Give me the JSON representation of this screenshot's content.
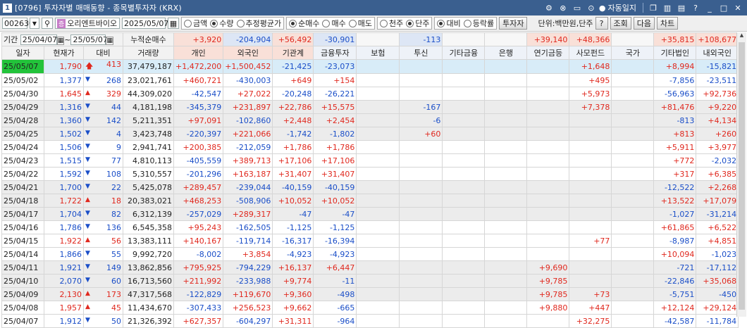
{
  "title": {
    "num": "1",
    "text": "[0796] 투자자별 매매동향 - 종목별투자자 (KRX)",
    "autolock": "자동일지"
  },
  "toolbar": {
    "code": "002630",
    "name": "오리엔트바이오",
    "date": "2025/05/07",
    "r1": [
      "금액",
      "수량",
      "추정평균가"
    ],
    "r1sel": 1,
    "r2": [
      "순매수",
      "매수",
      "매도"
    ],
    "r2sel": 0,
    "r3": [
      "천주",
      "단주"
    ],
    "r3sel": 1,
    "r4": [
      "대비",
      "등락률"
    ],
    "r4sel": 0,
    "investor_btn": "투자자",
    "unit": "단위:백만원,단주",
    "help": "?",
    "lookup": "조회",
    "next": "다음",
    "chart": "차트"
  },
  "period": {
    "label": "기간",
    "from": "25/04/07",
    "tilde": "~",
    "to": "25/05/07",
    "cumul": "누적순매수"
  },
  "headers": [
    "일자",
    "현재가",
    "대비",
    "거래량",
    "개인",
    "외국인",
    "기관계",
    "금융투자",
    "보험",
    "투신",
    "기타금융",
    "은행",
    "연기금등",
    "사모펀드",
    "국가",
    "기타법인",
    "내외국인"
  ],
  "summary": [
    "",
    "",
    "",
    "",
    "+3,920",
    "-204,904",
    "+56,492",
    "-30,901",
    "",
    "-113",
    "",
    "",
    "+39,140",
    "+48,366",
    "",
    "+35,815",
    "+108,677"
  ],
  "rows": [
    {
      "d": "25/05/07",
      "p": "1,790",
      "dir": "up2",
      "c": "413",
      "v": "37,479,187",
      "vals": [
        "+1,472,200",
        "+1,500,452",
        "-21,425",
        "-23,073",
        "",
        "",
        "",
        "",
        "",
        "+1,648",
        "",
        "+8,994",
        "-15,821"
      ]
    },
    {
      "d": "25/05/02",
      "p": "1,377",
      "dir": "dn",
      "c": "268",
      "v": "23,021,761",
      "vals": [
        "+460,721",
        "-430,003",
        "+649",
        "+154",
        "",
        "",
        "",
        "",
        "",
        "+495",
        "",
        "-7,856",
        "-23,511"
      ]
    },
    {
      "d": "25/04/30",
      "p": "1,645",
      "dir": "up",
      "c": "329",
      "v": "44,309,020",
      "vals": [
        "-42,547",
        "+27,022",
        "-20,248",
        "-26,221",
        "",
        "",
        "",
        "",
        "",
        "+5,973",
        "",
        "-56,963",
        "+92,736"
      ]
    },
    {
      "d": "25/04/29",
      "p": "1,316",
      "dir": "dn",
      "c": "44",
      "v": "4,181,198",
      "vals": [
        "-345,379",
        "+231,897",
        "+22,786",
        "+15,575",
        "",
        "-167",
        "",
        "",
        "",
        "+7,378",
        "",
        "+81,476",
        "+9,220"
      ]
    },
    {
      "d": "25/04/28",
      "p": "1,360",
      "dir": "dn",
      "c": "142",
      "v": "5,211,351",
      "vals": [
        "+97,091",
        "-102,860",
        "+2,448",
        "+2,454",
        "",
        "-6",
        "",
        "",
        "",
        "",
        "",
        "-813",
        "+4,134"
      ]
    },
    {
      "d": "25/04/25",
      "p": "1,502",
      "dir": "dn",
      "c": "4",
      "v": "3,423,748",
      "vals": [
        "-220,397",
        "+221,066",
        "-1,742",
        "-1,802",
        "",
        "+60",
        "",
        "",
        "",
        "",
        "",
        "+813",
        "+260"
      ]
    },
    {
      "d": "25/04/24",
      "p": "1,506",
      "dir": "dn",
      "c": "9",
      "v": "2,941,741",
      "vals": [
        "+200,385",
        "-212,059",
        "+1,786",
        "+1,786",
        "",
        "",
        "",
        "",
        "",
        "",
        "",
        "+5,911",
        "+3,977"
      ]
    },
    {
      "d": "25/04/23",
      "p": "1,515",
      "dir": "dn",
      "c": "77",
      "v": "4,810,113",
      "vals": [
        "-405,559",
        "+389,713",
        "+17,106",
        "+17,106",
        "",
        "",
        "",
        "",
        "",
        "",
        "",
        "+772",
        "-2,032"
      ]
    },
    {
      "d": "25/04/22",
      "p": "1,592",
      "dir": "dn",
      "c": "108",
      "v": "5,310,557",
      "vals": [
        "-201,296",
        "+163,187",
        "+31,407",
        "+31,407",
        "",
        "",
        "",
        "",
        "",
        "",
        "",
        "+317",
        "+6,385"
      ]
    },
    {
      "d": "25/04/21",
      "p": "1,700",
      "dir": "dn",
      "c": "22",
      "v": "5,425,078",
      "vals": [
        "+289,457",
        "-239,044",
        "-40,159",
        "-40,159",
        "",
        "",
        "",
        "",
        "",
        "",
        "",
        "-12,522",
        "+2,268"
      ]
    },
    {
      "d": "25/04/18",
      "p": "1,722",
      "dir": "up",
      "c": "18",
      "v": "20,383,021",
      "vals": [
        "+468,253",
        "-508,906",
        "+10,052",
        "+10,052",
        "",
        "",
        "",
        "",
        "",
        "",
        "",
        "+13,522",
        "+17,079"
      ]
    },
    {
      "d": "25/04/17",
      "p": "1,704",
      "dir": "dn",
      "c": "82",
      "v": "6,312,139",
      "vals": [
        "-257,029",
        "+289,317",
        "-47",
        "-47",
        "",
        "",
        "",
        "",
        "",
        "",
        "",
        "-1,027",
        "-31,214"
      ]
    },
    {
      "d": "25/04/16",
      "p": "1,786",
      "dir": "dn",
      "c": "136",
      "v": "6,545,358",
      "vals": [
        "+95,243",
        "-162,505",
        "-1,125",
        "-1,125",
        "",
        "",
        "",
        "",
        "",
        "",
        "",
        "+61,865",
        "+6,522"
      ]
    },
    {
      "d": "25/04/15",
      "p": "1,922",
      "dir": "up",
      "c": "56",
      "v": "13,383,111",
      "vals": [
        "+140,167",
        "-119,714",
        "-16,317",
        "-16,394",
        "",
        "",
        "",
        "",
        "",
        "+77",
        "",
        "-8,987",
        "+4,851"
      ]
    },
    {
      "d": "25/04/14",
      "p": "1,866",
      "dir": "dn",
      "c": "55",
      "v": "9,992,720",
      "vals": [
        "-8,002",
        "+3,854",
        "-4,923",
        "-4,923",
        "",
        "",
        "",
        "",
        "",
        "",
        "",
        "+10,094",
        "-1,023"
      ]
    },
    {
      "d": "25/04/11",
      "p": "1,921",
      "dir": "dn",
      "c": "149",
      "v": "13,862,856",
      "vals": [
        "+795,925",
        "-794,229",
        "+16,137",
        "+6,447",
        "",
        "",
        "",
        "",
        "+9,690",
        "",
        "",
        "-721",
        "-17,112"
      ]
    },
    {
      "d": "25/04/10",
      "p": "2,070",
      "dir": "dn",
      "c": "60",
      "v": "16,713,560",
      "vals": [
        "+211,992",
        "-233,988",
        "+9,774",
        "-11",
        "",
        "",
        "",
        "",
        "+9,785",
        "",
        "",
        "-22,846",
        "+35,068"
      ]
    },
    {
      "d": "25/04/09",
      "p": "2,130",
      "dir": "up",
      "c": "173",
      "v": "47,317,568",
      "vals": [
        "-122,829",
        "+119,670",
        "+9,360",
        "-498",
        "",
        "",
        "",
        "",
        "+9,785",
        "+73",
        "",
        "-5,751",
        "-450"
      ]
    },
    {
      "d": "25/04/08",
      "p": "1,957",
      "dir": "up",
      "c": "45",
      "v": "11,434,670",
      "vals": [
        "-307,433",
        "+256,523",
        "+9,662",
        "-665",
        "",
        "",
        "",
        "",
        "+9,880",
        "+447",
        "",
        "+12,124",
        "+29,124"
      ]
    },
    {
      "d": "25/04/07",
      "p": "1,912",
      "dir": "dn",
      "c": "50",
      "v": "21,326,392",
      "vals": [
        "+627,357",
        "-604,297",
        "+31,311",
        "-964",
        "",
        "",
        "",
        "",
        "",
        "+32,275",
        "",
        "-42,587",
        "-11,784"
      ]
    }
  ],
  "colors": {
    "pos": "#e0281e",
    "neg": "#1a4ec8",
    "summary_pos_bg": "#f9e0d8",
    "summary_neg_bg": "#dde6f5",
    "date_sel_bg": "#22c33a"
  },
  "icons": {
    "dropdown": "chevron-down-icon",
    "search": "search-icon",
    "calendar": "calendar-icon",
    "lock": "lock-icon"
  }
}
